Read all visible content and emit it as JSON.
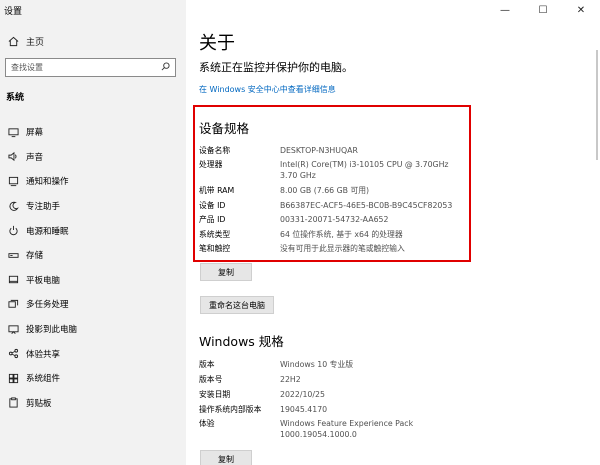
{
  "window": {
    "title": "设置",
    "minimize": "—",
    "maximize": "☐",
    "close": "✕"
  },
  "sidebar": {
    "home_label": "主页",
    "search_placeholder": "查找设置",
    "section_label": "系统",
    "items": [
      {
        "label": "屏幕",
        "icon": "monitor-icon"
      },
      {
        "label": "声音",
        "icon": "speaker-icon"
      },
      {
        "label": "通知和操作",
        "icon": "notification-icon"
      },
      {
        "label": "专注助手",
        "icon": "moon-icon"
      },
      {
        "label": "电源和睡眠",
        "icon": "power-icon"
      },
      {
        "label": "存储",
        "icon": "storage-icon"
      },
      {
        "label": "平板电脑",
        "icon": "tablet-icon"
      },
      {
        "label": "多任务处理",
        "icon": "multitask-icon"
      },
      {
        "label": "投影到此电脑",
        "icon": "projection-icon"
      },
      {
        "label": "体验共享",
        "icon": "share-icon"
      },
      {
        "label": "系统组件",
        "icon": "components-icon"
      },
      {
        "label": "剪贴板",
        "icon": "clipboard-icon"
      }
    ]
  },
  "main": {
    "title": "关于",
    "subtitle": "系统正在监控并保护你的电脑。",
    "security_link": "在 Windows 安全中心中查看详细信息",
    "device_spec": {
      "title": "设备规格",
      "rows": [
        {
          "key": "设备名称",
          "value": "DESKTOP-N3HUQAR"
        },
        {
          "key": "处理器",
          "value": "Intel(R) Core(TM) i3-10105 CPU @ 3.70GHz   3.70 GHz"
        },
        {
          "key": "机带 RAM",
          "value": "8.00 GB (7.66 GB 可用)"
        },
        {
          "key": "设备 ID",
          "value": "B66387EC-ACF5-46E5-BC0B-B9C45CF82053"
        },
        {
          "key": "产品 ID",
          "value": "00331-20071-54732-AA652"
        },
        {
          "key": "系统类型",
          "value": "64 位操作系统, 基于 x64 的处理器"
        },
        {
          "key": "笔和触控",
          "value": "没有可用于此显示器的笔或触控输入"
        }
      ],
      "copy_button": "复制",
      "rename_button": "重命名这台电脑"
    },
    "windows_spec": {
      "title": "Windows 规格",
      "rows": [
        {
          "key": "版本",
          "value": "Windows 10 专业版"
        },
        {
          "key": "版本号",
          "value": "22H2"
        },
        {
          "key": "安装日期",
          "value": "2022/10/25"
        },
        {
          "key": "操作系统内部版本",
          "value": "19045.4170"
        },
        {
          "key": "体验",
          "value": "Windows Feature Experience Pack 1000.19054.1000.0"
        }
      ],
      "copy_button": "复制"
    }
  }
}
